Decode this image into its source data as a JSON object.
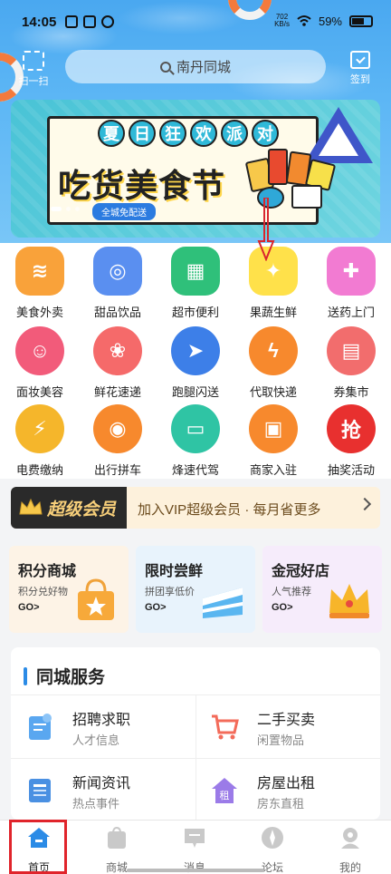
{
  "status_bar": {
    "time": "14:05",
    "net_speed": "702",
    "net_unit": "KB/s",
    "battery": "59%"
  },
  "header": {
    "scan_label": "扫一扫",
    "search_placeholder": "南丹同城",
    "checkin_label": "签到"
  },
  "banner": {
    "top_chars": [
      "夏",
      "日",
      "狂",
      "欢",
      "派",
      "对"
    ],
    "headline": "吃货美食节",
    "tag": "全城免配送"
  },
  "services": [
    {
      "label": "美食外卖",
      "icon": "noodle-bowl-icon",
      "color": "#f9a23a"
    },
    {
      "label": "甜品饮品",
      "icon": "donut-icon",
      "color": "#5a8ff0"
    },
    {
      "label": "超市便利",
      "icon": "basket-icon",
      "color": "#2fc07a"
    },
    {
      "label": "果蔬生鲜",
      "icon": "pineapple-icon",
      "color": "#ffe14a"
    },
    {
      "label": "送药上门",
      "icon": "medicine-box-icon",
      "color": "#f27bd2"
    },
    {
      "label": "面妆美容",
      "icon": "beauty-face-icon",
      "color": "#f25b7a"
    },
    {
      "label": "鲜花速递",
      "icon": "flower-icon",
      "color": "#f56a6a"
    },
    {
      "label": "跑腿闪送",
      "icon": "scooter-icon",
      "color": "#3d7fe8"
    },
    {
      "label": "代取快递",
      "icon": "lightning-runner-icon",
      "color": "#f7892d"
    },
    {
      "label": "券集市",
      "icon": "ticket-icon",
      "color": "#f26d6d"
    },
    {
      "label": "电费缴纳",
      "icon": "electric-bill-icon",
      "color": "#f5b62b"
    },
    {
      "label": "出行拼车",
      "icon": "steering-wheel-icon",
      "color": "#f7892d"
    },
    {
      "label": "烽速代驾",
      "icon": "car-icon",
      "color": "#2fc4a4"
    },
    {
      "label": "商家入驻",
      "icon": "merchant-card-icon",
      "color": "#f7892d"
    },
    {
      "label": "抽奖活动",
      "icon": "lottery-icon",
      "color": "#e8302f"
    }
  ],
  "vip": {
    "badge": "超级会员",
    "message": "加入VIP超级会员 · 每月省更多"
  },
  "promos": [
    {
      "title": "积分商城",
      "sub": "积分兑好物",
      "go": "GO>",
      "bg": "#fdf3e6",
      "icon": "shopping-bag-icon"
    },
    {
      "title": "限时尝鲜",
      "sub": "拼团享低价",
      "go": "GO>",
      "bg": "#e8f3fc",
      "icon": "cake-icon"
    },
    {
      "title": "金冠好店",
      "sub": "人气推荐",
      "go": "GO>",
      "bg": "#f6ecfb",
      "icon": "crown-icon"
    }
  ],
  "city_services": {
    "title": "同城服务",
    "items": [
      {
        "title": "招聘求职",
        "sub": "人才信息",
        "icon": "recruit-icon",
        "color": "#5aa7f0"
      },
      {
        "title": "二手买卖",
        "sub": "闲置物品",
        "icon": "cart-icon",
        "color": "#f36b5a"
      },
      {
        "title": "新闻资讯",
        "sub": "热点事件",
        "icon": "news-icon",
        "color": "#4a90e2"
      },
      {
        "title": "房屋出租",
        "sub": "房东直租",
        "icon": "rent-house-icon",
        "color": "#9b7be8"
      }
    ]
  },
  "bottom_nav": [
    {
      "label": "首页",
      "icon": "home-icon",
      "active": true
    },
    {
      "label": "商城",
      "icon": "shop-bag-icon",
      "active": false
    },
    {
      "label": "消息",
      "icon": "message-icon",
      "active": false
    },
    {
      "label": "论坛",
      "icon": "compass-icon",
      "active": false
    },
    {
      "label": "我的",
      "icon": "profile-icon",
      "active": false
    }
  ]
}
